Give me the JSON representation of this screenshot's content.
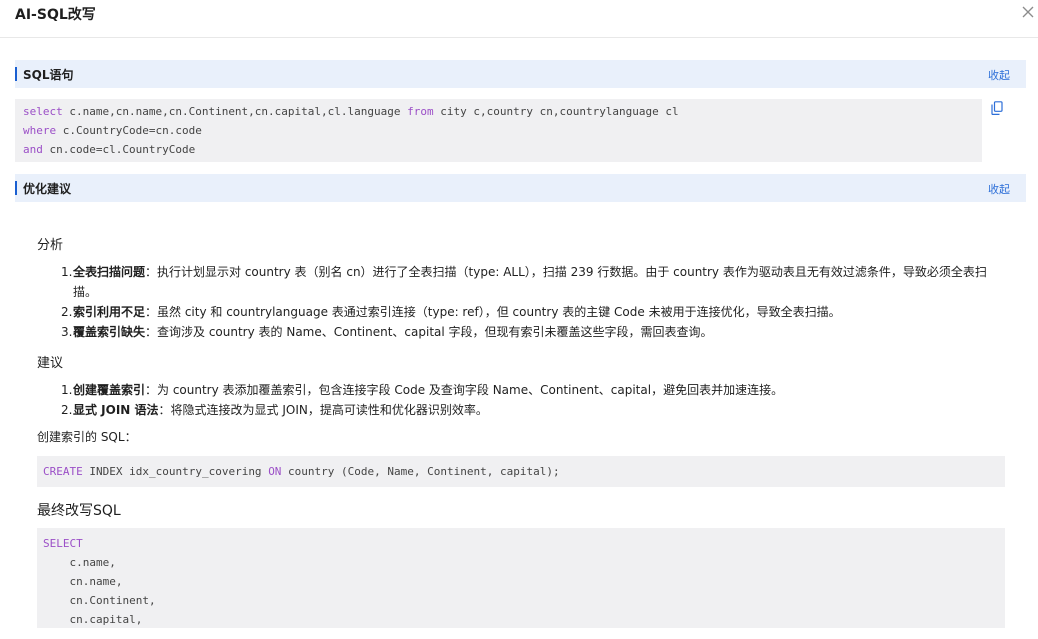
{
  "dialog": {
    "title": "AI-SQL改写"
  },
  "sql_section": {
    "label": "SQL语句",
    "toggle_label": "收起",
    "code_lines": [
      [
        {
          "kw": "select"
        },
        {
          "t": " c.name,cn.name,cn.Continent,cn.capital,cl.language "
        },
        {
          "kw": "from"
        },
        {
          "t": " city c,country cn,countrylanguage cl"
        }
      ],
      [
        {
          "kw": "where"
        },
        {
          "t": " c.CountryCode=cn.code"
        }
      ],
      [
        {
          "kw": "and"
        },
        {
          "t": " cn.code=cl.CountryCode"
        }
      ]
    ]
  },
  "opt_section": {
    "label": "优化建议",
    "toggle_label": "收起"
  },
  "analysis": {
    "heading": "分析",
    "items": [
      {
        "num": "1.",
        "bold": "全表扫描问题",
        "text": "：执行计划显示对 country 表（别名 cn）进行了全表扫描（type: ALL），扫描 239 行数据。由于 country 表作为驱动表且无有效过滤条件，导致必须全表扫描。"
      },
      {
        "num": "2.",
        "bold": "索引利用不足",
        "text": "：虽然 city 和 countrylanguage 表通过索引连接（type: ref），但 country 表的主键 Code 未被用于连接优化，导致全表扫描。"
      },
      {
        "num": "3.",
        "bold": "覆盖索引缺失",
        "text": "：查询涉及 country 表的 Name、Continent、capital 字段，但现有索引未覆盖这些字段，需回表查询。"
      }
    ]
  },
  "suggestions": {
    "heading": "建议",
    "items": [
      {
        "num": "1.",
        "bold": "创建覆盖索引",
        "text": "：为 country 表添加覆盖索引，包含连接字段 Code 及查询字段 Name、Continent、capital，避免回表并加速连接。"
      },
      {
        "num": "2.",
        "bold": "显式 JOIN 语法",
        "text": "：将隐式连接改为显式 JOIN，提高可读性和优化器识别效率。"
      }
    ]
  },
  "create_index": {
    "label": "创建索引的 SQL：",
    "code_lines": [
      [
        {
          "kw": "CREATE"
        },
        {
          "t": " INDEX idx_country_covering "
        },
        {
          "kw": "ON"
        },
        {
          "t": " country (Code, Name, Continent, capital);"
        }
      ]
    ]
  },
  "final_sql": {
    "heading": "最终改写SQL",
    "code_lines": [
      [
        {
          "kw": "SELECT"
        }
      ],
      [
        {
          "t": "    c.name,"
        }
      ],
      [
        {
          "t": "    cn.name,"
        }
      ],
      [
        {
          "t": "    cn.Continent,"
        }
      ],
      [
        {
          "t": "    cn.capital,"
        }
      ]
    ]
  },
  "icons": {
    "close": "close-icon",
    "copy": "copy-icon"
  },
  "colors": {
    "accent": "#1a5fd1",
    "link": "#2d6fd8",
    "keyword": "#9b4fc7",
    "section_bg": "#e9f0fb",
    "code_bg": "#f0f0f2"
  }
}
